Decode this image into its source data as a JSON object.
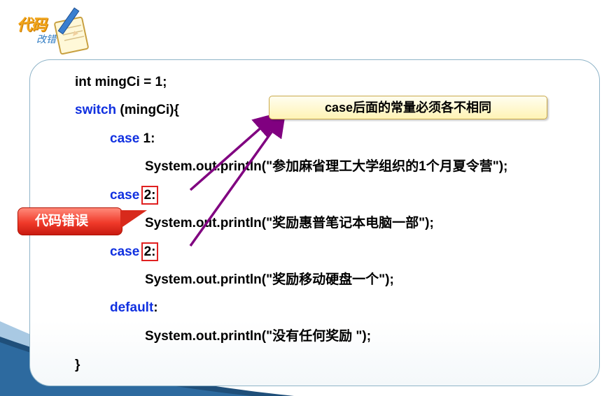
{
  "logo": {
    "line1": "代码",
    "line2": "改错"
  },
  "note": "case后面的常量必须各不相同",
  "error_label": "代码错误",
  "code": {
    "line1": "int mingCi = 1;",
    "switch_kw": "switch",
    "switch_rest": " (mingCi){",
    "case_kw": "case",
    "case1_val": " 1:",
    "println1": "System.out.println(\"参加麻省理工大学组织的1个月夏令营\");",
    "case2_val": "2:",
    "println2": "System.out.println(\"奖励惠普笔记本电脑一部\");",
    "case3_val": "2:",
    "println3": "System.out.println(\"奖励移动硬盘一个\");",
    "default_kw": "default",
    "default_colon": ":",
    "println4": "System.out.println(\"没有任何奖励 \");",
    "close_brace": "}"
  },
  "colors": {
    "keyword": "#1030e0",
    "error_box": "#e02020",
    "arrow": "#800080",
    "note_bg": "#fff3b5",
    "error_label_bg": "#f03a2a"
  }
}
